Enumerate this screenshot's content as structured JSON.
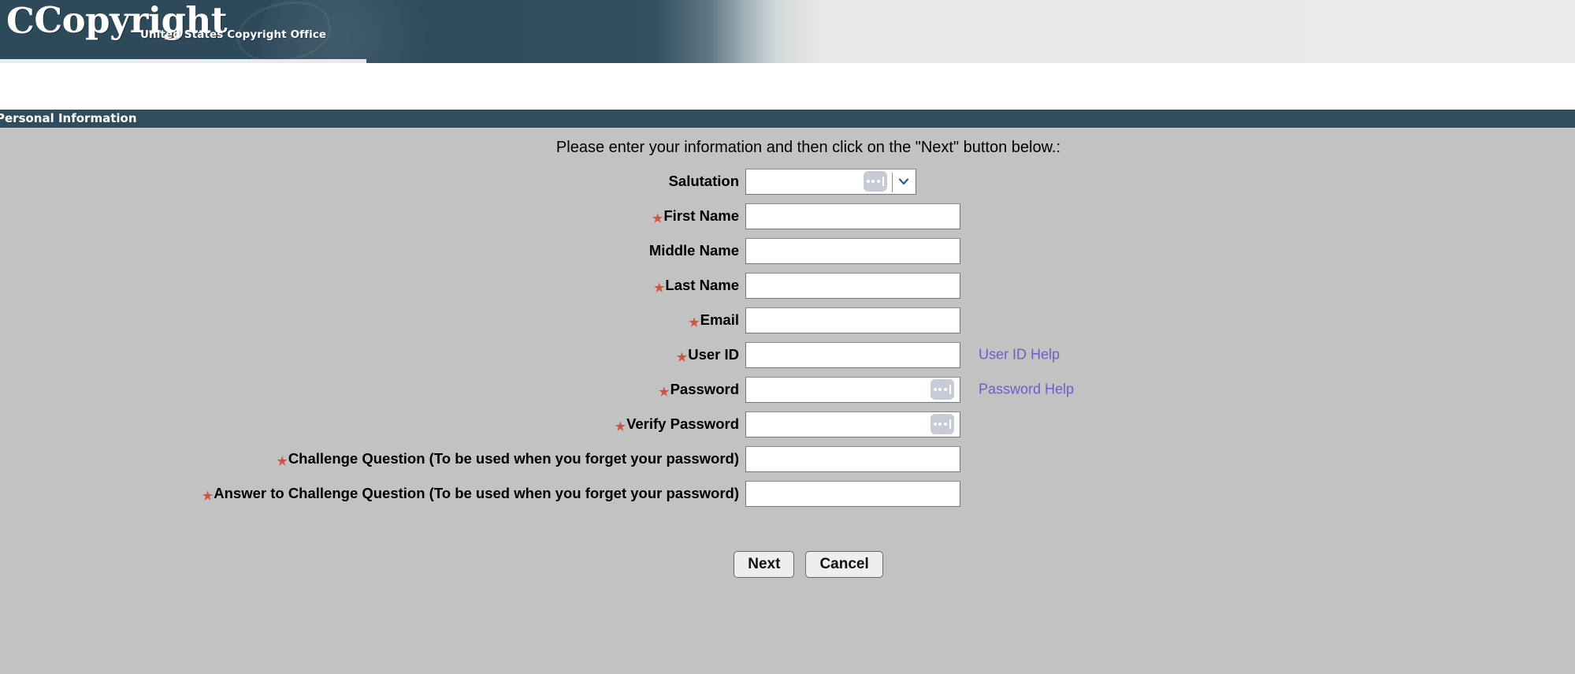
{
  "banner": {
    "logo_text": "Copyright",
    "logo_c_glyph": "C",
    "subtitle": "United States Copyright Office"
  },
  "section": {
    "title": "Personal Information"
  },
  "instruction": "Please enter your information and then click on the \"Next\" button below.:",
  "form": {
    "fields": [
      {
        "label": "Salutation",
        "required": false,
        "type": "select",
        "value": "",
        "help": null
      },
      {
        "label": "First Name",
        "required": true,
        "type": "text",
        "value": "",
        "help": null
      },
      {
        "label": "Middle Name",
        "required": false,
        "type": "text",
        "value": "",
        "help": null
      },
      {
        "label": "Last Name",
        "required": true,
        "type": "text",
        "value": "",
        "help": null
      },
      {
        "label": "Email",
        "required": true,
        "type": "text",
        "value": "",
        "help": null
      },
      {
        "label": "User ID",
        "required": true,
        "type": "text",
        "value": "",
        "help": "User ID Help"
      },
      {
        "label": "Password",
        "required": true,
        "type": "password",
        "value": "",
        "help": "Password Help"
      },
      {
        "label": "Verify Password",
        "required": true,
        "type": "password",
        "value": "",
        "help": null
      },
      {
        "label": "Challenge Question (To be used when you forget your password)",
        "required": true,
        "type": "text",
        "value": "",
        "help": null
      },
      {
        "label": "Answer to Challenge Question (To be used when you forget your password)",
        "required": true,
        "type": "text",
        "value": "",
        "help": null
      }
    ],
    "required_marker": "★"
  },
  "buttons": {
    "next_label": "Next",
    "cancel_label": "Cancel"
  },
  "colors": {
    "banner_dark": "#2d4a5a",
    "section_bar": "#2f4d5d",
    "page_background": "#c2c2c2",
    "required_star": "#cf5540",
    "help_link": "#6d5ec4",
    "select_caret": "#1f5fa8"
  }
}
